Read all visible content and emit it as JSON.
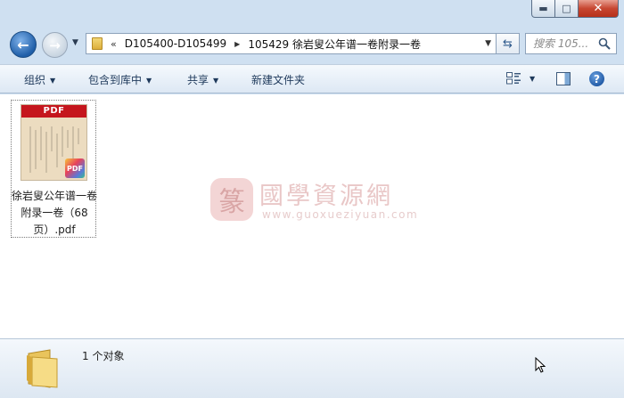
{
  "window": {
    "caption": {
      "minimize": "▬",
      "maximize": "□",
      "close": "✕"
    }
  },
  "nav": {
    "back_icon": "back-arrow-icon",
    "forward_icon": "forward-arrow-icon",
    "address": {
      "overflow": "«",
      "segments": [
        "D105400-D105499",
        "105429 徐岩叟公年谱一卷附录一卷"
      ],
      "separator": "▶"
    },
    "search_placeholder": "搜索 105..."
  },
  "toolbar": {
    "organize": "组织",
    "include_in_library": "包含到库中",
    "share": "共享",
    "new_folder": "新建文件夹",
    "help": "?"
  },
  "files": [
    {
      "name": "徐岩叟公年谱一卷附录一卷（68页）.pdf",
      "thumb_band": "PDF",
      "badge": "PDF"
    }
  ],
  "watermark": {
    "title": "國學資源網",
    "url": "www.guoxueziyuan.com"
  },
  "details": {
    "status": "1 个对象"
  },
  "colors": {
    "frame": "#cfe0f1",
    "pdf_red": "#c5161d",
    "link_text": "#1e395b"
  }
}
